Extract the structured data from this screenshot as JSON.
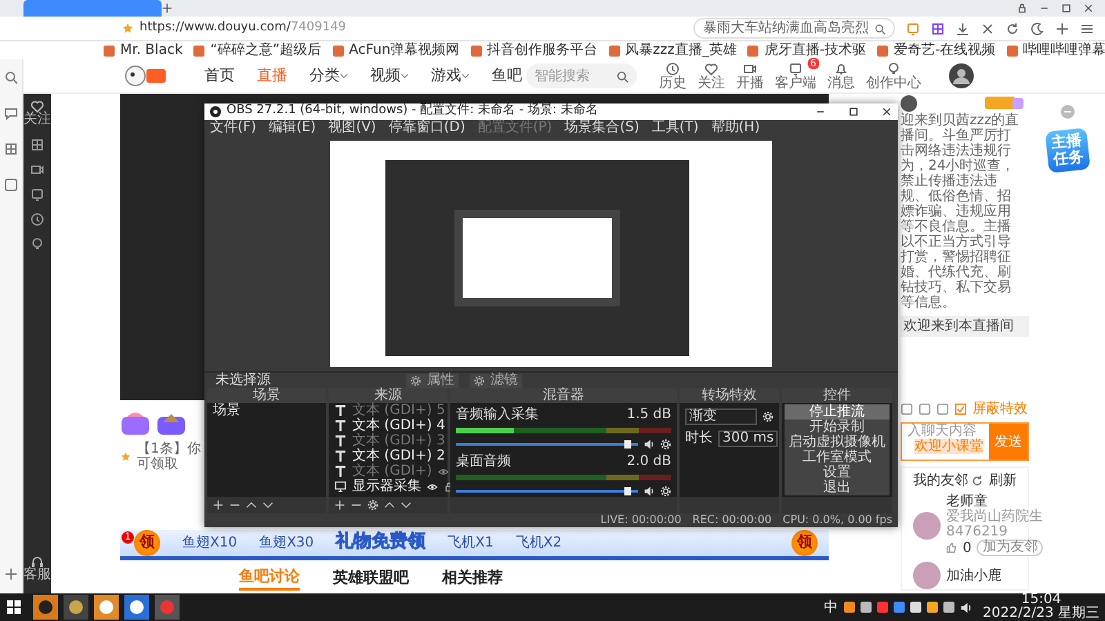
{
  "browser": {
    "tabs": [
      {
        "selected": true
      }
    ],
    "url_host": "https://www.douyu.com/",
    "url_path": "7409149",
    "search_text": "暴雨大车站纳满血高岛亮烈",
    "bookmarks": [
      "Mr. Black",
      "“碎碎之意”超级后",
      "AcFun弹幕视频网",
      "抖音创作服务平台",
      "风暴zzz直播_英雄",
      "虎牙直播-技术驱",
      "爱奇艺-在线视频",
      "哔哩哔哩弹幕"
    ]
  },
  "site_header": {
    "nav": [
      {
        "label": "首页",
        "selected": false,
        "dropdown": false
      },
      {
        "label": "直播",
        "selected": true,
        "dropdown": false
      },
      {
        "label": "分类",
        "selected": false,
        "dropdown": true
      },
      {
        "label": "视频",
        "selected": false,
        "dropdown": true
      },
      {
        "label": "游戏",
        "selected": false,
        "dropdown": true
      },
      {
        "label": "鱼吧",
        "selected": false,
        "dropdown": false
      }
    ],
    "search_placeholder": "智能搜索",
    "icons": [
      {
        "kind": "history",
        "label": "历史"
      },
      {
        "kind": "heart",
        "label": "关注"
      },
      {
        "kind": "camera",
        "label": "开播"
      },
      {
        "kind": "client",
        "label": "客户端",
        "badge": "6"
      },
      {
        "kind": "bell",
        "label": "消息"
      },
      {
        "kind": "bulb",
        "label": "创作中心"
      }
    ]
  },
  "side_nav": {
    "top": "关注",
    "bottom": "客服"
  },
  "player": {
    "gift_notice": "【1条】你可领取",
    "banner": {
      "claim": "领",
      "count": "1",
      "gifts": [
        "鱼翅X10",
        "鱼翅X30"
      ],
      "title": "礼物免费领",
      "gifts_right": [
        "飞机X1",
        "飞机X2"
      ],
      "claim_right": "领"
    },
    "tabs": [
      {
        "label": "鱼吧讨论",
        "selected": true
      },
      {
        "label": "英雄联盟吧",
        "selected": false
      },
      {
        "label": "相关推荐",
        "selected": false
      }
    ]
  },
  "obs": {
    "title": "OBS 27.2.1 (64-bit, windows) - 配置文件: 未命名 - 场景: 未命名",
    "menu": [
      {
        "label": "文件(F)",
        "disabled": false
      },
      {
        "label": "编辑(E)",
        "disabled": false
      },
      {
        "label": "视图(V)",
        "disabled": false
      },
      {
        "label": "停靠窗口(D)",
        "disabled": false
      },
      {
        "label": "配置文件(P)",
        "disabled": true
      },
      {
        "label": "场景集合(S)",
        "disabled": false
      },
      {
        "label": "工具(T)",
        "disabled": false
      },
      {
        "label": "帮助(H)",
        "disabled": false
      }
    ],
    "source_status": "未选择源",
    "source_buttons": [
      "属性",
      "滤镜"
    ],
    "scenes": {
      "title": "场景",
      "items": [
        {
          "name": "场景",
          "selected": false
        }
      ]
    },
    "sources": {
      "title": "来源",
      "items": [
        {
          "name": "文本 (GDI+) 5",
          "kind": "text",
          "visible": false
        },
        {
          "name": "文本 (GDI+) 4",
          "kind": "text",
          "visible": true
        },
        {
          "name": "文本 (GDI+) 3",
          "kind": "text",
          "visible": false
        },
        {
          "name": "文本 (GDI+) 2",
          "kind": "text",
          "visible": true
        },
        {
          "name": "文本 (GDI+)",
          "kind": "text",
          "visible": false
        },
        {
          "name": "显示器采集",
          "kind": "display",
          "visible": true
        }
      ]
    },
    "mixer": {
      "title": "混音器",
      "channels": [
        {
          "name": "音频输入采集",
          "reading": "1.5 dB",
          "meter": {
            "level": 0.27
          },
          "level": 0.96
        },
        {
          "name": "桌面音频",
          "reading": "2.0 dB",
          "meter": {
            "level": 0
          },
          "level": 0.96
        }
      ]
    },
    "transitions": {
      "title": "转场特效",
      "type": "渐变",
      "duration_label": "时长",
      "duration": "300 ms"
    },
    "controls": {
      "title": "控件",
      "buttons": [
        {
          "label": "停止推流",
          "highlighted": true
        },
        {
          "label": "开始录制",
          "highlighted": false
        },
        {
          "label": "启动虚拟摄像机",
          "highlighted": false
        },
        {
          "label": "工作室模式",
          "highlighted": false
        },
        {
          "label": "设置",
          "highlighted": false
        },
        {
          "label": "退出",
          "highlighted": false
        }
      ]
    },
    "status": [
      {
        "label": "LIVE:",
        "value": "00:00:00"
      },
      {
        "label": "REC:",
        "value": "00:00:00"
      },
      {
        "label": "CPU:",
        "value": "0.0%, 0.00 fps"
      }
    ]
  },
  "chat": {
    "rules": "迎来到贝茜zzz的直播间。斗鱼严厉打击网络违法违规行为，24小时巡查，禁止传播违法违规、低俗色情、招嫖诈骗、违规应用等不良信息。主播以不正当方式引导打赏，警惕招聘征婚、代练代充、刷钻技巧、私下交易等信息。",
    "welcome": "欢迎来到本直播间",
    "block_effects": {
      "label": "屏蔽特效",
      "checked": true
    },
    "input_placeholder": "入聊天内容",
    "tag": "欢迎小课堂",
    "send": "发送",
    "friends": {
      "title": "我的友邻",
      "refresh": "刷新",
      "items": [
        {
          "name": "老师童",
          "desc": "爱我尚山药院生 8476219",
          "likes": "0",
          "action": "加为友邻"
        },
        {
          "name": "加油小鹿"
        }
      ]
    }
  },
  "task_badge": "主播任务",
  "taskbar": {
    "ime": "中",
    "time": "15:04",
    "date": "2022/2/23 星期三"
  }
}
